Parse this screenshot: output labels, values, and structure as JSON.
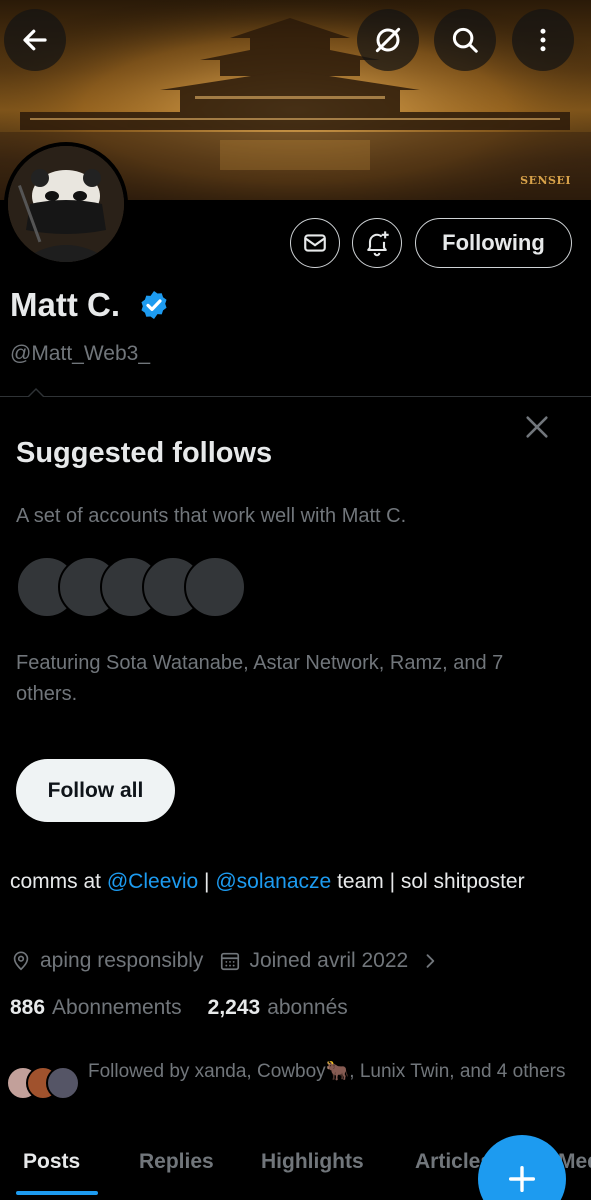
{
  "banner": {
    "watermark": "SENSEI"
  },
  "icons": {
    "back": "arrow-left-icon",
    "grok": "grok-icon",
    "search": "search-icon",
    "more": "more-vertical-icon",
    "message": "mail-icon",
    "notify": "bell-plus-icon",
    "verified": "verified-badge-icon",
    "close": "close-icon",
    "location": "location-pin-icon",
    "calendar": "calendar-icon",
    "chevron": "chevron-right-icon",
    "compose": "plus-icon"
  },
  "colors": {
    "accent": "#1d9bf0",
    "background": "#000000",
    "muted": "#71767b"
  },
  "profile": {
    "following_label": "Following",
    "name": "Matt C.",
    "handle": "@Matt_Web3_",
    "bio": {
      "prefix": "comms at ",
      "mention1": "@Cleevio",
      "sep": " | ",
      "mention2": "@solanacze",
      "suffix": " team | sol shitposter"
    },
    "location": "aping responsibly",
    "joined": "Joined avril 2022",
    "following_count": "886",
    "following_text": "Abonnements",
    "followers_count": "2,243",
    "followers_text": "abonnés",
    "followed_by": "Followed by xanda, Cowboy🐂, Lunix Twin, and 4 others"
  },
  "suggested": {
    "title": "Suggested follows",
    "description": "A set of accounts that work well with Matt C.",
    "featuring": "Featuring Sota Watanabe, Astar Network, Ramz, and 7 others.",
    "follow_all": "Follow all"
  },
  "tabs": [
    {
      "label": "Posts",
      "active": true
    },
    {
      "label": "Replies"
    },
    {
      "label": "Highlights"
    },
    {
      "label": "Articles"
    },
    {
      "label": "Media"
    }
  ]
}
